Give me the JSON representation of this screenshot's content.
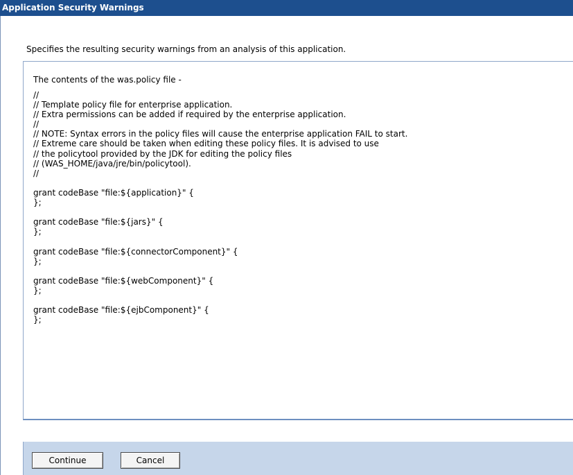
{
  "dialog": {
    "title": "Application Security Warnings",
    "description": "Specifies the resulting security warnings from an analysis of this application."
  },
  "policy": {
    "heading": "The contents of the was.policy file -",
    "lines": [
      "//",
      "// Template policy file for enterprise application.",
      "// Extra permissions can be added if required by the enterprise application.",
      "//",
      "// NOTE: Syntax errors in the policy files will cause the enterprise application FAIL to start.",
      "// Extreme care should be taken when editing these policy files. It is advised to use",
      "// the policytool provided by the JDK for editing the policy files",
      "// (WAS_HOME/java/jre/bin/policytool).",
      "//",
      "",
      "grant codeBase \"file:${application}\" {",
      "};",
      "",
      "grant codeBase \"file:${jars}\" {",
      "};",
      "",
      "grant codeBase \"file:${connectorComponent}\" {",
      "};",
      "",
      "grant codeBase \"file:${webComponent}\" {",
      "};",
      "",
      "grant codeBase \"file:${ejbComponent}\" {",
      "};"
    ]
  },
  "buttons": {
    "continue_label": "Continue",
    "cancel_label": "Cancel"
  },
  "colors": {
    "title_bar": "#1d4f8e",
    "button_bar": "#c6d6ea",
    "panel_border": "#8ea6c9"
  }
}
